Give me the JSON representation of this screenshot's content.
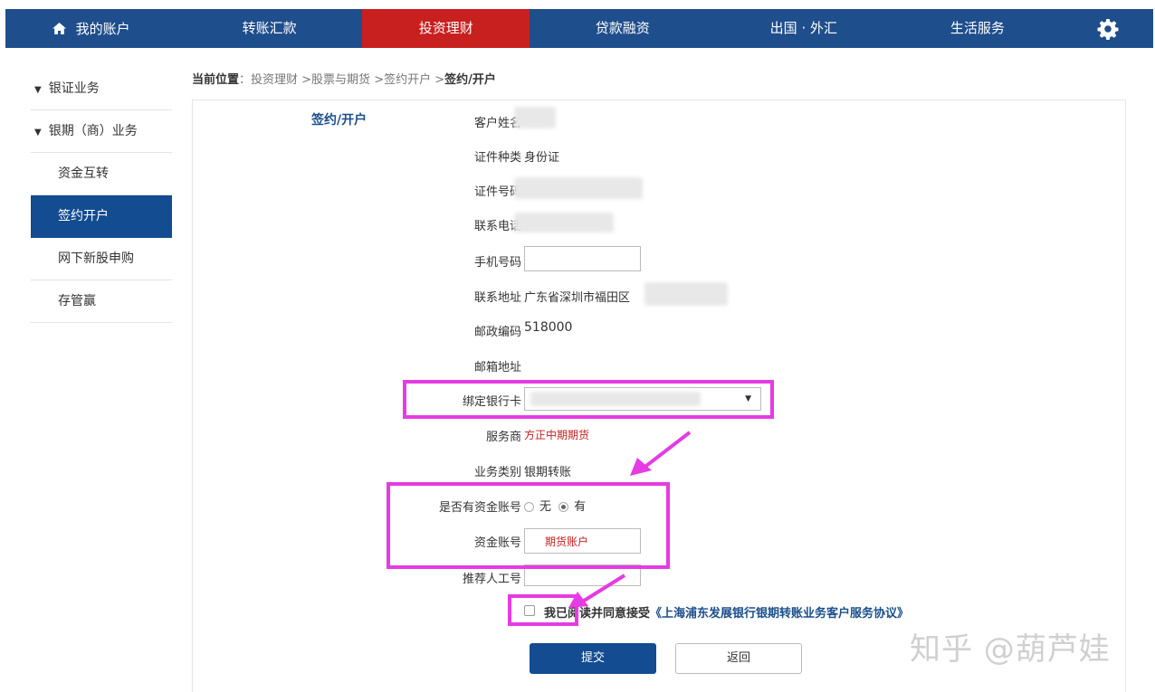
{
  "nav": {
    "items": [
      {
        "label": "我的账户"
      },
      {
        "label": "转账汇款"
      },
      {
        "label": "投资理财"
      },
      {
        "label": "贷款融资"
      },
      {
        "label": "出国 · 外汇"
      },
      {
        "label": "生活服务"
      }
    ],
    "active_index": 2,
    "home_icon": "home-icon",
    "settings_icon": "gear-icon"
  },
  "sidebar": {
    "groups": [
      {
        "label": "银证业务"
      },
      {
        "label": "银期（商）业务"
      }
    ],
    "items": [
      {
        "label": "资金互转"
      },
      {
        "label": "签约开户"
      },
      {
        "label": "网下新股申购"
      },
      {
        "label": "存管赢"
      }
    ],
    "active_item": "签约开户"
  },
  "breadcrumb": {
    "prefix": "当前位置",
    "sep": "：",
    "path": "投资理财 >股票与期货 >签约开户 >",
    "current": "签约/开户"
  },
  "form": {
    "heading": "签约/开户",
    "customer_name_label": "客户姓名",
    "id_type_label": "证件种类",
    "id_type_value": "身份证",
    "id_number_label": "证件号码",
    "phone_label": "联系电话",
    "mobile_label": "手机号码",
    "mobile_value": "",
    "address_label": "联系地址",
    "address_value": "广东省深圳市福田区",
    "postcode_label": "邮政编码",
    "postcode_value": "518000",
    "email_label": "邮箱地址",
    "card_label": "绑定银行卡",
    "provider_label": "服务商",
    "provider_value": "方正中期期货",
    "biz_type_label": "业务类别",
    "biz_type_value": "银期转账",
    "has_account_label": "是否有资金账号",
    "opt_no": "无",
    "opt_yes": "有",
    "has_account_selected": "有",
    "fund_account_label": "资金账号",
    "fund_account_value": "期货账户",
    "referrer_label": "推荐人工号",
    "referrer_value": "",
    "agree_text": "我已阅读并同意接受",
    "agree_link": "《上海浦东发展银行银期转账业务客户服务协议》",
    "agree_checked": false,
    "submit_label": "提交",
    "back_label": "返回"
  },
  "annotation_color": "#e53be3",
  "watermark": "知乎 @葫芦娃",
  "colors": {
    "nav_bg": "#1f4e8c",
    "nav_active": "#c8201f",
    "sidebar_active": "#134c91",
    "accent_red": "#c8201f"
  }
}
